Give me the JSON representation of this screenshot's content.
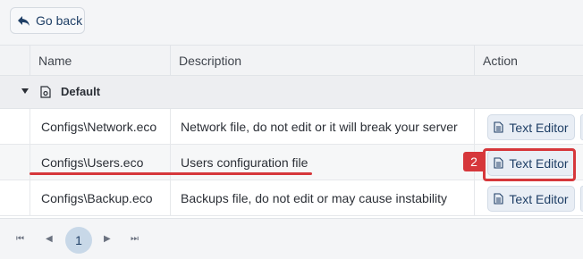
{
  "toolbar": {
    "back_label": "Go back"
  },
  "table": {
    "columns": [
      "Name",
      "Description",
      "Action"
    ],
    "group": {
      "label": "Default"
    },
    "rows": [
      {
        "name": "Configs\\Network.eco",
        "description": "Network file, do not edit or it will break your server",
        "action": "Text Editor"
      },
      {
        "name": "Configs\\Users.eco",
        "description": "Users configuration file",
        "action": "Text Editor"
      },
      {
        "name": "Configs\\Backup.eco",
        "description": "Backups file, do not edit or may cause instability",
        "action": "Text Editor"
      }
    ]
  },
  "annotation": {
    "step": "2",
    "color": "#d6373b"
  },
  "pager": {
    "first": "⏮",
    "prev": "◀",
    "current_page": "1",
    "next": "▶",
    "last": "⏭"
  },
  "colors": {
    "accent": "#1f3f66",
    "button_bg": "#e9eef5",
    "highlight": "#d6373b"
  }
}
